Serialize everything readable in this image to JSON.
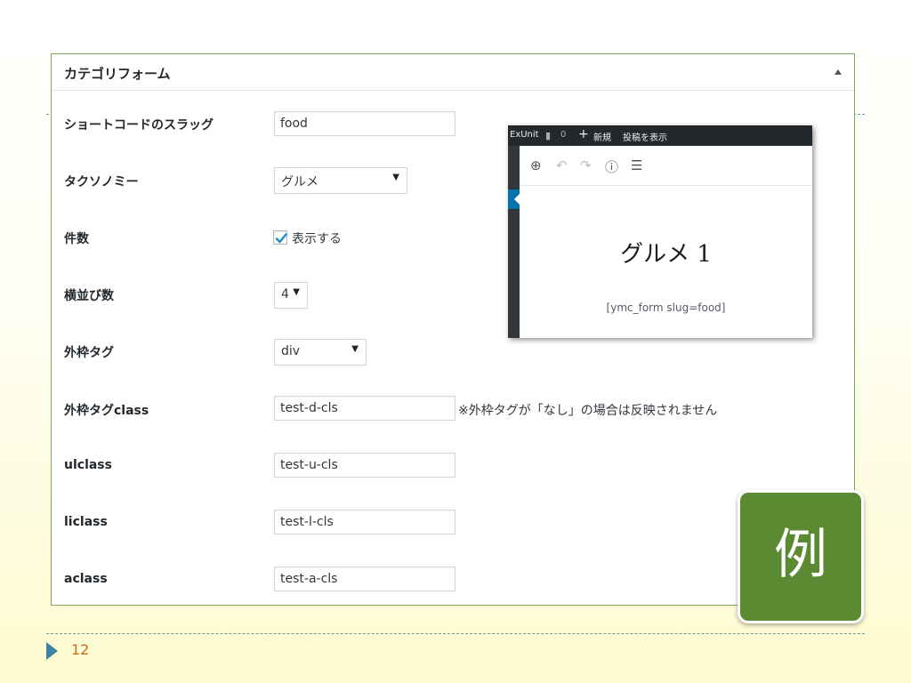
{
  "panel": {
    "title": "カテゴリフォーム"
  },
  "form": {
    "slug": {
      "label": "ショートコードのスラッグ",
      "value": "food"
    },
    "taxonomy": {
      "label": "タクソノミー",
      "selected": "グルメ"
    },
    "count": {
      "label": "件数",
      "checkbox_checked": true,
      "checkbox_label": "表示する"
    },
    "columns": {
      "label": "横並び数",
      "selected": "4"
    },
    "wrapper_tag": {
      "label": "外枠タグ",
      "selected": "div"
    },
    "wrapper_class": {
      "label": "外枠タグclass",
      "value": "test-d-cls",
      "note": "※外枠タグが「なし」の場合は反映されません"
    },
    "ul_class": {
      "label": "ulclass",
      "value": "test-u-cls"
    },
    "li_class": {
      "label": "liclass",
      "value": "test-l-cls"
    },
    "a_class": {
      "label": "aclass",
      "value": "test-a-cls"
    }
  },
  "preview": {
    "adminbar": {
      "site": "ExUnit",
      "comments_count": "0",
      "new_label": "新規",
      "view_post_label": "投稿を表示"
    },
    "toolbar_icons": [
      "add-block-icon",
      "undo-icon",
      "redo-icon",
      "info-icon",
      "outline-icon"
    ],
    "heading": "グルメ 1",
    "shortcode": "[ymc_form slug=food]"
  },
  "badge": {
    "label": "例"
  },
  "slide": {
    "page_number": "12"
  },
  "colors": {
    "panel_border": "#7ea55a",
    "badge_bg": "#5b8a32",
    "page_marker": "#3b82a4",
    "page_number": "#c46a2b",
    "wp_admin_bar": "#23282d",
    "wp_active_menu": "#0073aa"
  }
}
